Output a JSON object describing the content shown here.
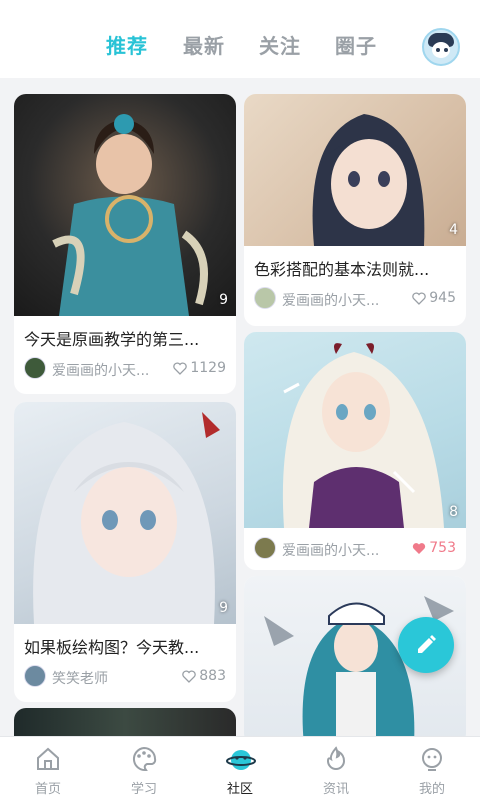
{
  "header": {
    "tabs": [
      {
        "label": "推荐",
        "active": true
      },
      {
        "label": "最新",
        "active": false
      },
      {
        "label": "关注",
        "active": false
      },
      {
        "label": "圈子",
        "active": false
      }
    ]
  },
  "posts": [
    {
      "count": "9",
      "title": "今天是原画教学的第三...",
      "author": "爱画画的小天...",
      "likes": "1129",
      "liked": false
    },
    {
      "count": "4",
      "title": "色彩搭配的基本法则就...",
      "author": "爱画画的小天...",
      "likes": "945",
      "liked": false
    },
    {
      "count": "9",
      "title": "如果板绘构图？今天教...",
      "author": "笑笑老师",
      "likes": "883",
      "liked": false
    },
    {
      "count": "8",
      "title": "",
      "author": "爱画画的小天...",
      "likes": "753",
      "liked": true
    }
  ],
  "nav": {
    "items": [
      {
        "label": "首页",
        "icon": "home-icon"
      },
      {
        "label": "学习",
        "icon": "palette-icon"
      },
      {
        "label": "社区",
        "icon": "planet-icon",
        "active": true
      },
      {
        "label": "资讯",
        "icon": "flame-icon"
      },
      {
        "label": "我的",
        "icon": "profile-icon"
      }
    ]
  },
  "colors": {
    "accent": "#29c3d6",
    "liked": "#f07a8a",
    "muted": "#9aa0a6"
  }
}
